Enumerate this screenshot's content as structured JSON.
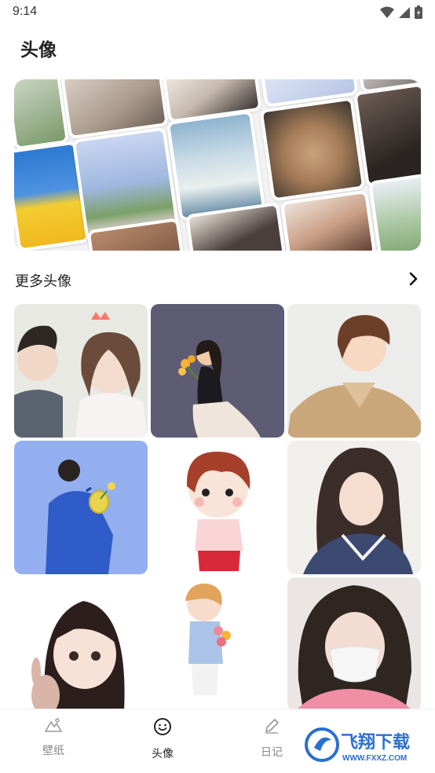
{
  "status_bar": {
    "time": "9:14"
  },
  "header": {
    "title": "头像"
  },
  "section": {
    "title": "更多头像"
  },
  "grid": [
    {
      "name": "avatar-couple-wedding",
      "bg": "#e8e8e4"
    },
    {
      "name": "avatar-girl-flowers-purple",
      "bg": "#5d5a73"
    },
    {
      "name": "avatar-boy-coat",
      "bg": "#ececec"
    },
    {
      "name": "avatar-boy-blue-shirt",
      "bg": "#95b0f0"
    },
    {
      "name": "avatar-chibi-boy",
      "bg": "#ffffff"
    },
    {
      "name": "avatar-girl-sailor",
      "bg": "#f1efed"
    },
    {
      "name": "avatar-chibi-girl-bunny",
      "bg": "#ffffff"
    },
    {
      "name": "avatar-chibi-boy-bouquet",
      "bg": "#ffffff"
    },
    {
      "name": "avatar-girl-mask",
      "bg": "#ece8e6"
    }
  ],
  "nav": {
    "items": [
      {
        "label": "壁纸",
        "icon": "mountain-icon",
        "active": false
      },
      {
        "label": "头像",
        "icon": "smiley-icon",
        "active": true
      },
      {
        "label": "日记",
        "icon": "pencil-icon",
        "active": false
      }
    ]
  },
  "watermark": {
    "text": "飞翔下载",
    "url_text": "WWW.FXXZ.COM"
  },
  "colors": {
    "text_primary": "#222222",
    "text_secondary": "#888888",
    "divider": "#eeeeee",
    "watermark": "#2a6fd1"
  }
}
